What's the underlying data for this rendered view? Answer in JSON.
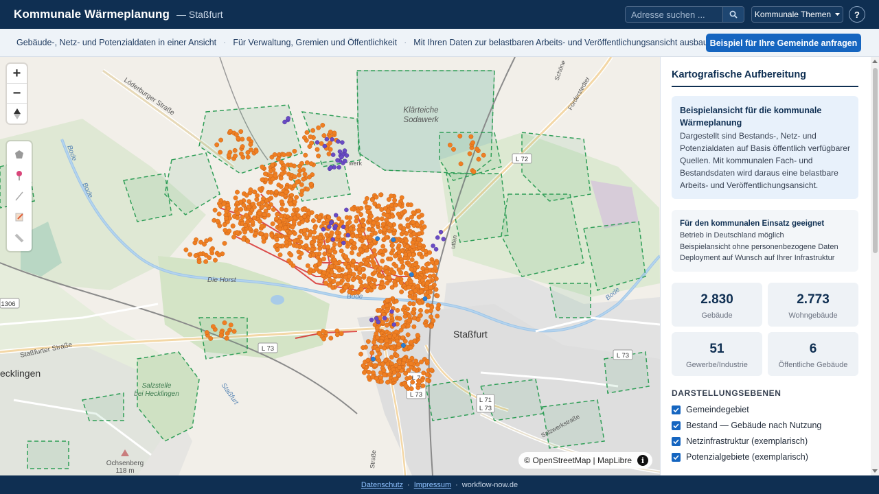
{
  "header": {
    "title": "Kommunale Wärmeplanung",
    "subtitle": "— Staßfurt",
    "search_placeholder": "Adresse suchen ...",
    "themes_label": "Kommunale Themen",
    "help_label": "?"
  },
  "strip": {
    "items": [
      "Gebäude-, Netz- und Potenzialdaten in einer Ansicht",
      "Für Verwaltung, Gremien und Öffentlichkeit",
      "Mit Ihren Daten zur belastbaren Arbeits- und Veröffentlichungsansicht ausbaubar"
    ],
    "separator": "·",
    "cta_label": "Beispiel für Ihre Gemeinde anfragen"
  },
  "map": {
    "labels": {
      "town": "Staßfurt",
      "klaerteiche_1": "Klärteiche",
      "klaerteiche_2": "Sodawerk",
      "die_horst": "Die Horst",
      "bode_1": "Bode",
      "bode_2": "Bode",
      "bode_3": "Bode",
      "bode_4": "Bode",
      "loederburger": "Löderburger Straße",
      "stassfurter": "Staßfurter Straße",
      "stassfurt_road": "Staßfurt",
      "salzstelle_1": "Salzstelle",
      "salzstelle_2": "bei Hecklingen",
      "hecklingen": "ecklingen",
      "ochsenberg": "Ochsenberg",
      "ochsenberg_h": "118 m",
      "l72": "L 72",
      "l73a": "L 73",
      "l73b": "L 73",
      "r1306": "1306",
      "l7": "L 7",
      "l72b": "L 72",
      "l73c": "L 73",
      "l71": "L 71",
      "l73d": "L 73",
      "strasse": "Straße",
      "salzwerk": "Salzwerkstraße",
      "foerderstedter": "Förderstedter",
      "schoenebecker": "Schöne",
      "werk": "werk",
      "gutten": "utten"
    },
    "attribution": "© OpenStreetMap | MapLibre",
    "zoom_in": "+",
    "zoom_out": "−",
    "colors": {
      "residential": "#ef7f22",
      "commercial": "#6a4bc4",
      "public": "#2a7fd4",
      "network": "#d7302f",
      "potential": "#2f9e57"
    }
  },
  "panel": {
    "title": "Kartografische Aufbereitung",
    "card1_title": "Beispielansicht für die kommunale Wärmeplanung",
    "card1_text": "Dargestellt sind Bestands-, Netz- und Potenzialdaten auf Basis öffentlich verfügbarer Quellen. Mit kommunalen Fach- und Bestandsdaten wird daraus eine belastbare Arbeits- und Veröffentlichungsansicht.",
    "card2_title": "Für den kommunalen Einsatz geeignet",
    "card2_lines": [
      "Betrieb in Deutschland möglich",
      "Beispielansicht ohne personenbezogene Daten",
      "Deployment auf Wunsch auf Ihrer Infrastruktur"
    ],
    "stats": [
      {
        "value": "2.830",
        "label": "Gebäude"
      },
      {
        "value": "2.773",
        "label": "Wohngebäude"
      },
      {
        "value": "51",
        "label": "Gewerbe/Industrie"
      },
      {
        "value": "6",
        "label": "Öffentliche Gebäude"
      }
    ],
    "layers_title": "DARSTELLUNGSEBENEN",
    "layers": [
      "Gemeindegebiet",
      "Bestand — Gebäude nach Nutzung",
      "Netzinfrastruktur (exemplarisch)",
      "Potenzialgebiete (exemplarisch)"
    ]
  },
  "footer": {
    "datenschutz": "Datenschutz",
    "impressum": "Impressum",
    "site": "workflow-now.de",
    "sep": "·"
  }
}
